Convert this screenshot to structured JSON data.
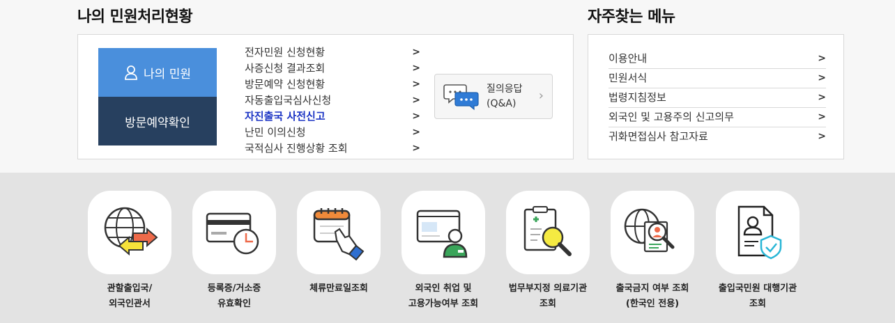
{
  "my_status": {
    "title": "나의 민원처리현황",
    "my_button": "나의 민원",
    "visit_button": "방문예약확인",
    "links": [
      "전자민원 신청현황",
      "사증신청 결과조회",
      "방문예약 신청현황",
      "자동출입국심사신청",
      "자진출국 사전신고",
      "난민 이의신청",
      "국적심사 진행상황 조회"
    ],
    "chevron": ">",
    "qa": {
      "line1": "질의응답",
      "line2": "(Q&A)"
    }
  },
  "faq_menu": {
    "title": "자주찾는 메뉴",
    "items": [
      "이용안내",
      "민원서식",
      "법령지침정보",
      "외국인 및 고용주의 신고의무",
      "귀화면접심사 참고자료"
    ]
  },
  "services": [
    {
      "label": "관할출입국/\n외국인관서",
      "icon": "globe-arrows-icon"
    },
    {
      "label": "등록증/거소증\n유효확인",
      "icon": "card-clock-icon"
    },
    {
      "label": "체류만료일조회",
      "icon": "calendar-hand-icon"
    },
    {
      "label": "외국인 취업 및\n고용가능여부 조회",
      "icon": "worker-screen-icon"
    },
    {
      "label": "법무부지정 의료기관\n조회",
      "icon": "medical-search-icon"
    },
    {
      "label": "출국금지 여부 조회\n(한국인 전용)",
      "icon": "globe-profile-search-icon"
    },
    {
      "label": "출입국민원 대행기관\n조회",
      "icon": "document-shield-icon"
    }
  ],
  "colors": {
    "my_button": "#4a8fdc",
    "visit_button": "#27405f",
    "highlight_link": "#1a33c4"
  }
}
